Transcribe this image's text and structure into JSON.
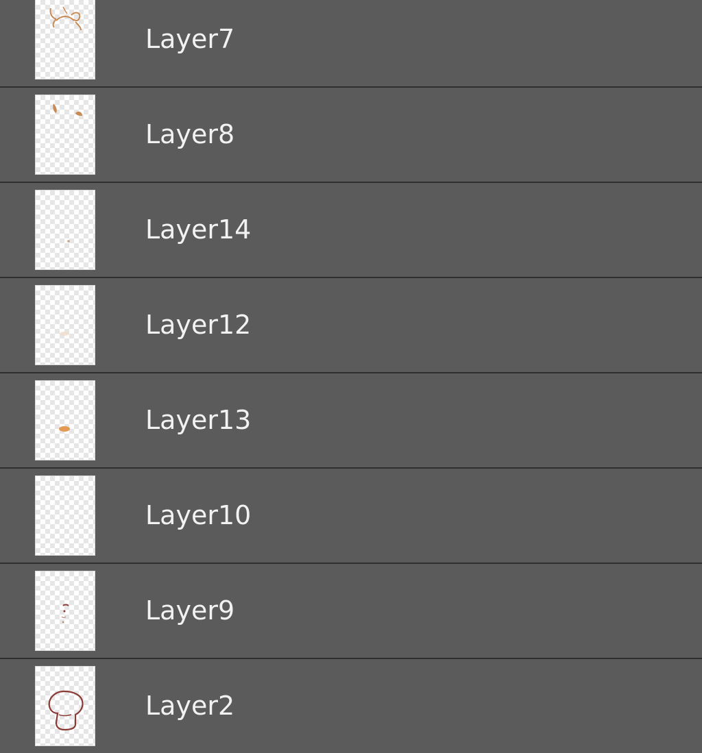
{
  "layers_panel": {
    "layers": [
      {
        "name": "Layer7",
        "thumbnail_icon": "ears-sketch-thumbnail"
      },
      {
        "name": "Layer8",
        "thumbnail_icon": "ear-tips-thumbnail"
      },
      {
        "name": "Layer14",
        "thumbnail_icon": "tiny-dot-thumbnail"
      },
      {
        "name": "Layer12",
        "thumbnail_icon": "faint-blush-thumbnail"
      },
      {
        "name": "Layer13",
        "thumbnail_icon": "orange-spot-thumbnail"
      },
      {
        "name": "Layer10",
        "thumbnail_icon": "empty-thumbnail"
      },
      {
        "name": "Layer9",
        "thumbnail_icon": "face-marks-thumbnail"
      },
      {
        "name": "Layer2",
        "thumbnail_icon": "head-outline-thumbnail"
      }
    ]
  },
  "colors": {
    "panel_background": "#5b5b5b",
    "divider": "#2f2f2f",
    "text": "#f2f2f2",
    "sketch_orange": "#c98a55",
    "outline_brown": "#8a3a34"
  }
}
